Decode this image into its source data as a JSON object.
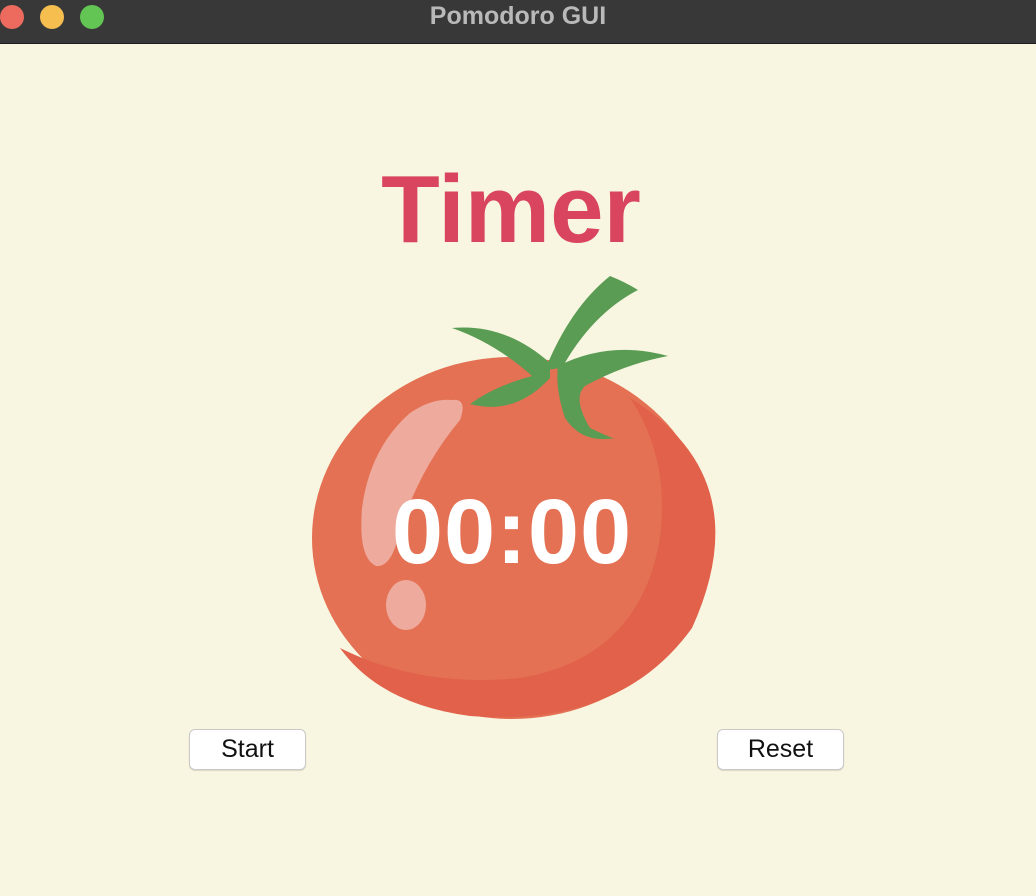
{
  "window": {
    "title": "Pomodoro GUI",
    "controls": [
      "close",
      "minimize",
      "maximize"
    ]
  },
  "heading": "Timer",
  "timer": {
    "display": "00:00",
    "graphic": "tomato"
  },
  "buttons": {
    "start_label": "Start",
    "reset_label": "Reset"
  },
  "colors": {
    "background": "#f8f5e0",
    "heading": "#d9455f",
    "tomato": "#e47153",
    "leaf": "#5a9c53",
    "timer_text": "#ffffff"
  }
}
